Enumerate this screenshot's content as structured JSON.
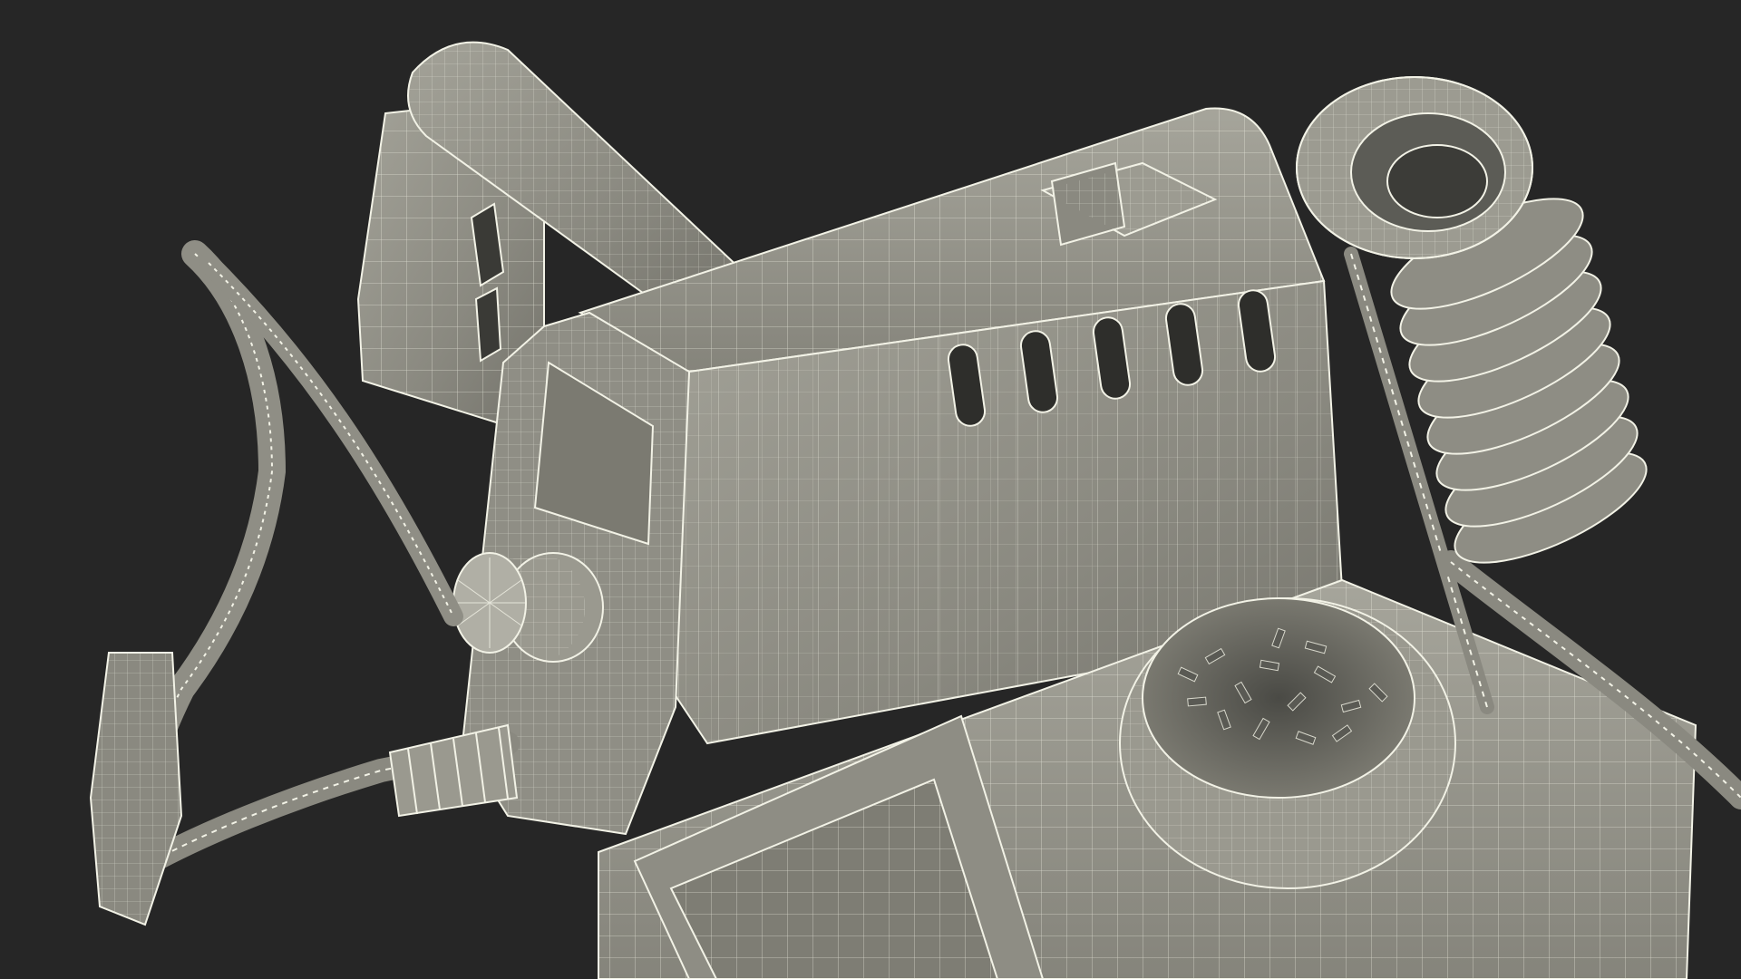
{
  "scene": {
    "subject": "soldering-station-wireframe",
    "background_color": "#262626",
    "body_color": "#8e8d83",
    "body_dark_color": "#6f6e66",
    "body_light_color": "#a8a79d",
    "wire_color": "#f2f2e6",
    "shadow_color": "#3a3a36",
    "icons": [
      "soldering-station-body",
      "iron-holder-coil",
      "sponge-tray",
      "temperature-knob",
      "cable-clip",
      "power-switch"
    ]
  }
}
